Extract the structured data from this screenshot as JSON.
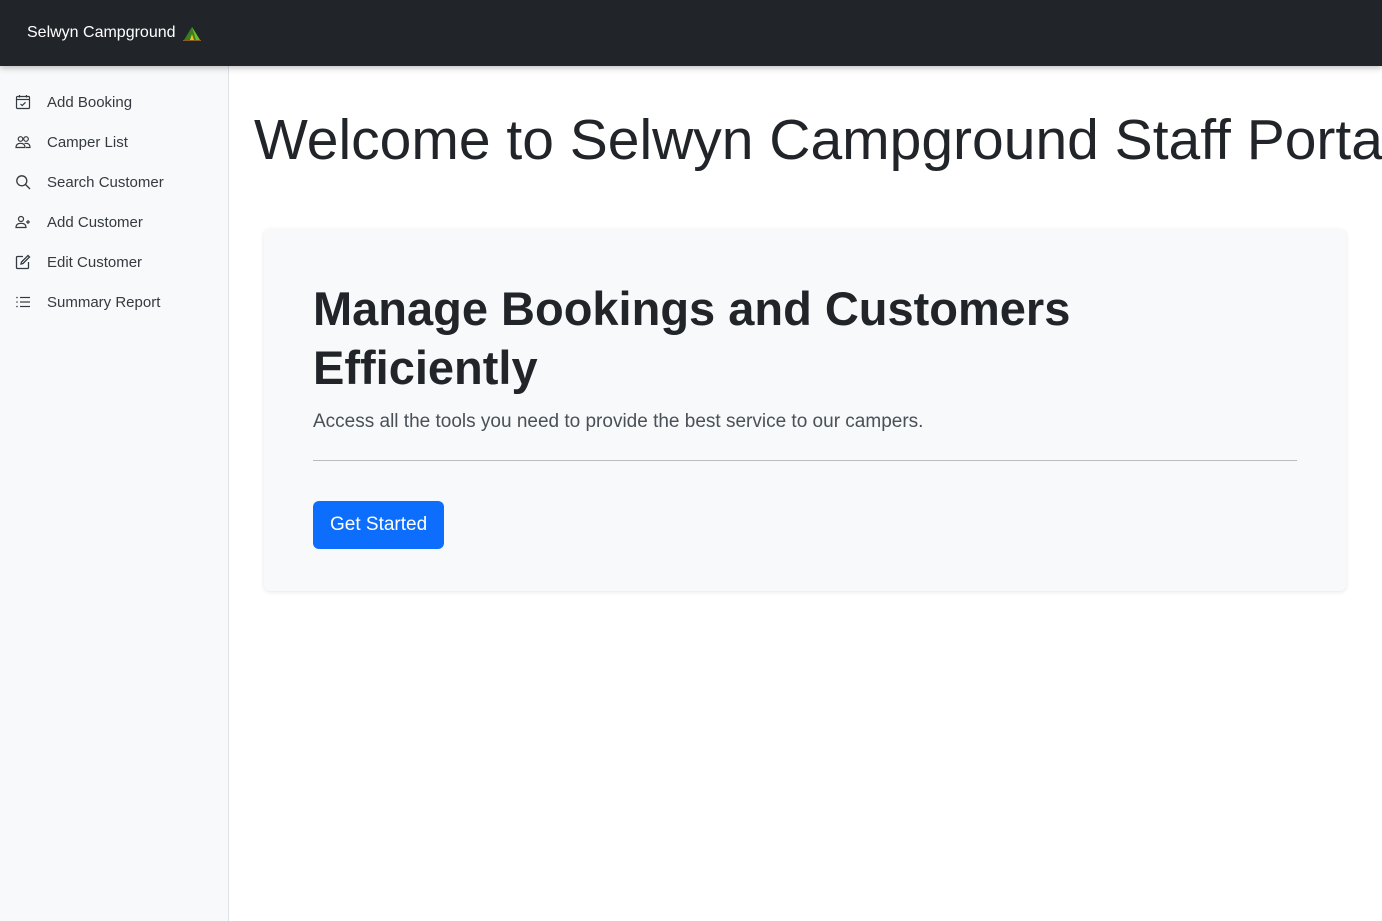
{
  "header": {
    "brand": "Selwyn Campground",
    "brand_icon": "tent-icon"
  },
  "sidebar": {
    "items": [
      {
        "label": "Add Booking",
        "icon": "calendar-check-icon"
      },
      {
        "label": "Camper List",
        "icon": "people-icon"
      },
      {
        "label": "Search Customer",
        "icon": "search-icon"
      },
      {
        "label": "Add Customer",
        "icon": "person-add-icon"
      },
      {
        "label": "Edit Customer",
        "icon": "pencil-square-icon"
      },
      {
        "label": "Summary Report",
        "icon": "list-icon"
      }
    ]
  },
  "main": {
    "title": "Welcome to Selwyn Campground Staff Portal",
    "hero": {
      "heading": "Manage Bookings and Customers Efficiently",
      "lead": "Access all the tools you need to provide the best service to our campers.",
      "button_label": "Get Started"
    }
  },
  "colors": {
    "navbar": "#212529",
    "sidebar": "#f8f9fa",
    "primary": "#0d6efd"
  }
}
